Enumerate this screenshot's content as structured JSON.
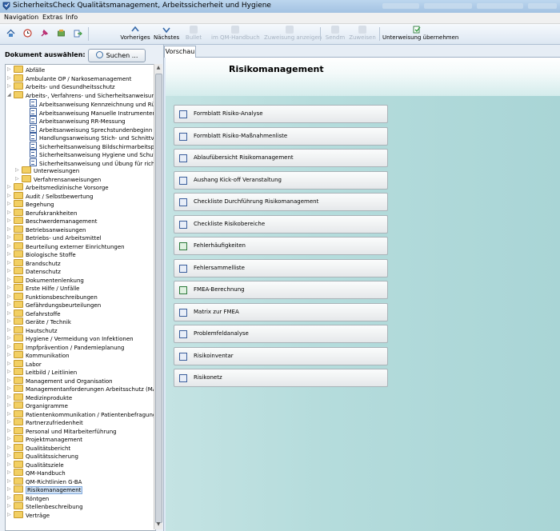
{
  "window": {
    "title": "SicherheitsCheck Qualitätsmanagement, Arbeitssicherheit und Hygiene"
  },
  "menu": [
    "Navigation",
    "Extras",
    "Info"
  ],
  "toolbar": {
    "icons": [
      "home-icon",
      "clock-icon",
      "pin-icon",
      "tools-icon",
      "export-icon"
    ],
    "prev_label": "Vorheriges",
    "next_label": "Nächstes",
    "disabled_labels": [
      "Bullet",
      "im QM-Handbuch",
      "Zuweisung anzeigen",
      "Sendm",
      "Zuweisen"
    ],
    "instruction_label": "Unterweisung übernehmen"
  },
  "left": {
    "doc_label": "Dokument auswählen:",
    "search_label": "Suchen ...",
    "tree": [
      {
        "label": "Abfälle",
        "type": "folder",
        "level": 0
      },
      {
        "label": "Ambulante OP / Narkosemanagement",
        "type": "folder",
        "level": 0
      },
      {
        "label": "Arbeits- und Gesundheitsschutz",
        "type": "folder",
        "level": 0
      },
      {
        "label": "Arbeits-, Verfahrens- und Sicherheitsanweisungen",
        "type": "folder",
        "level": 0,
        "expanded": true
      },
      {
        "label": "Arbeitsanweisung Kennzeichnung und Rü",
        "type": "doc",
        "level": 2
      },
      {
        "label": "Arbeitsanweisung Manuelle Instrumenten",
        "type": "doc",
        "level": 2
      },
      {
        "label": "Arbeitsanweisung RR-Messung",
        "type": "doc",
        "level": 2
      },
      {
        "label": "Arbeitsanweisung Sprechstundenbeginn",
        "type": "doc",
        "level": 2
      },
      {
        "label": "Handlungsanweisung Stich- und Schnittve",
        "type": "doc",
        "level": 2
      },
      {
        "label": "Sicherheitsanweisung Bildschirmarbeitsplä",
        "type": "doc",
        "level": 2
      },
      {
        "label": "Sicherheitsanweisung Hygiene und Schutz",
        "type": "doc",
        "level": 2
      },
      {
        "label": "Sicherheitsanweisung und Übung für richt",
        "type": "doc",
        "level": 2
      },
      {
        "label": "Unterweisungen",
        "type": "folder",
        "level": 1
      },
      {
        "label": "Verfahrensanweisungen",
        "type": "folder",
        "level": 1
      },
      {
        "label": "Arbeitsmedizinische Vorsorge",
        "type": "folder",
        "level": 0
      },
      {
        "label": "Audit / Selbstbewertung",
        "type": "folder",
        "level": 0
      },
      {
        "label": "Begehung",
        "type": "folder",
        "level": 0
      },
      {
        "label": "Berufskrankheiten",
        "type": "folder",
        "level": 0
      },
      {
        "label": "Beschwerdemanagement",
        "type": "folder",
        "level": 0
      },
      {
        "label": "Betriebsanweisungen",
        "type": "folder",
        "level": 0
      },
      {
        "label": "Betriebs- und Arbeitsmittel",
        "type": "folder",
        "level": 0
      },
      {
        "label": "Beurteilung externer Einrichtungen",
        "type": "folder",
        "level": 0
      },
      {
        "label": "Biologische Stoffe",
        "type": "folder",
        "level": 0
      },
      {
        "label": "Brandschutz",
        "type": "folder",
        "level": 0
      },
      {
        "label": "Datenschutz",
        "type": "folder",
        "level": 0
      },
      {
        "label": "Dokumentenlenkung",
        "type": "folder",
        "level": 0
      },
      {
        "label": "Erste Hilfe / Unfälle",
        "type": "folder",
        "level": 0
      },
      {
        "label": "Funktionsbeschreibungen",
        "type": "folder",
        "level": 0
      },
      {
        "label": "Gefährdungsbeurteilungen",
        "type": "folder",
        "level": 0
      },
      {
        "label": "Gefahrstoffe",
        "type": "folder",
        "level": 0
      },
      {
        "label": "Geräte / Technik",
        "type": "folder",
        "level": 0
      },
      {
        "label": "Hautschutz",
        "type": "folder",
        "level": 0
      },
      {
        "label": "Hygiene / Vermeidung von Infektionen",
        "type": "folder",
        "level": 0
      },
      {
        "label": "Impfprävention / Pandemieplanung",
        "type": "folder",
        "level": 0
      },
      {
        "label": "Kommunikation",
        "type": "folder",
        "level": 0
      },
      {
        "label": "Labor",
        "type": "folder",
        "level": 0
      },
      {
        "label": "Leitbild / Leitlinien",
        "type": "folder",
        "level": 0
      },
      {
        "label": "Management und Organisation",
        "type": "folder",
        "level": 0
      },
      {
        "label": "Managementanforderungen Arbeitsschutz (MAAS",
        "type": "folder",
        "level": 0
      },
      {
        "label": "Medizinprodukte",
        "type": "folder",
        "level": 0
      },
      {
        "label": "Organigramme",
        "type": "folder",
        "level": 0
      },
      {
        "label": "Patientenkommunikation / Patientenbefragung",
        "type": "folder",
        "level": 0
      },
      {
        "label": "Partnerzufriedenheit",
        "type": "folder",
        "level": 0
      },
      {
        "label": "Personal und Mitarbeiterführung",
        "type": "folder",
        "level": 0
      },
      {
        "label": "Projektmanagement",
        "type": "folder",
        "level": 0
      },
      {
        "label": "Qualitätsbericht",
        "type": "folder",
        "level": 0
      },
      {
        "label": "Qualitätssicherung",
        "type": "folder",
        "level": 0
      },
      {
        "label": "Qualitätsziele",
        "type": "folder",
        "level": 0
      },
      {
        "label": "QM-Handbuch",
        "type": "folder",
        "level": 0
      },
      {
        "label": "QM-Richtlinien G-BA",
        "type": "folder",
        "level": 0
      },
      {
        "label": "Risikomanagement",
        "type": "folder",
        "level": 0,
        "selected": true
      },
      {
        "label": "Röntgen",
        "type": "folder",
        "level": 0
      },
      {
        "label": "Stellenbeschreibung",
        "type": "folder",
        "level": 0
      },
      {
        "label": "Verträge",
        "type": "folder",
        "level": 0
      }
    ]
  },
  "right": {
    "tab_label": "Vorschau",
    "title": "Risikomanagement",
    "buttons": [
      {
        "label": "Formblatt Risiko-Analyse",
        "icon": "word-doc-icon"
      },
      {
        "label": "Formblatt Risiko-Maßnahmenliste",
        "icon": "word-doc-icon"
      },
      {
        "label": "Ablaufübersicht Risikomanagement",
        "icon": "word-doc-icon"
      },
      {
        "label": "Aushang Kick-off Veranstaltung",
        "icon": "word-doc-icon"
      },
      {
        "label": "Checkliste Durchführung Risikomanagement",
        "icon": "word-doc-icon"
      },
      {
        "label": "Checkliste Risikobereiche",
        "icon": "word-doc-icon"
      },
      {
        "label": "Fehlerhäufigkeiten",
        "icon": "excel-doc-icon"
      },
      {
        "label": "Fehlersammelliste",
        "icon": "word-doc-icon"
      },
      {
        "label": "FMEA-Berechnung",
        "icon": "excel-doc-icon"
      },
      {
        "label": "Matrix zur FMEA",
        "icon": "word-doc-icon"
      },
      {
        "label": "Problemfeldanalyse",
        "icon": "word-doc-icon"
      },
      {
        "label": "Risikoinventar",
        "icon": "word-doc-icon"
      },
      {
        "label": "Risikonetz",
        "icon": "word-doc-icon"
      }
    ]
  }
}
